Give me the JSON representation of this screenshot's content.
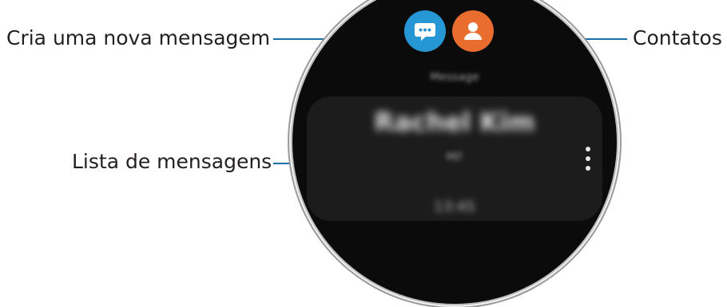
{
  "callouts": {
    "compose": "Cria uma nova mensagem",
    "contacts": "Contatos",
    "message_list": "Lista de mensagens"
  },
  "screen": {
    "app_title": "Message",
    "message": {
      "sender": "Rachel Kim",
      "preview": "Hi!",
      "time": "13:45"
    }
  },
  "icons": {
    "compose": "chat-bubble-icon",
    "contacts": "person-icon",
    "more": "more-options-icon"
  },
  "colors": {
    "compose_button": "#2796d4",
    "contacts_button": "#e86d2e",
    "leader_line": "#1b6ea8",
    "screen_background": "#0b0b0b",
    "card_background": "#1c1c1c"
  }
}
